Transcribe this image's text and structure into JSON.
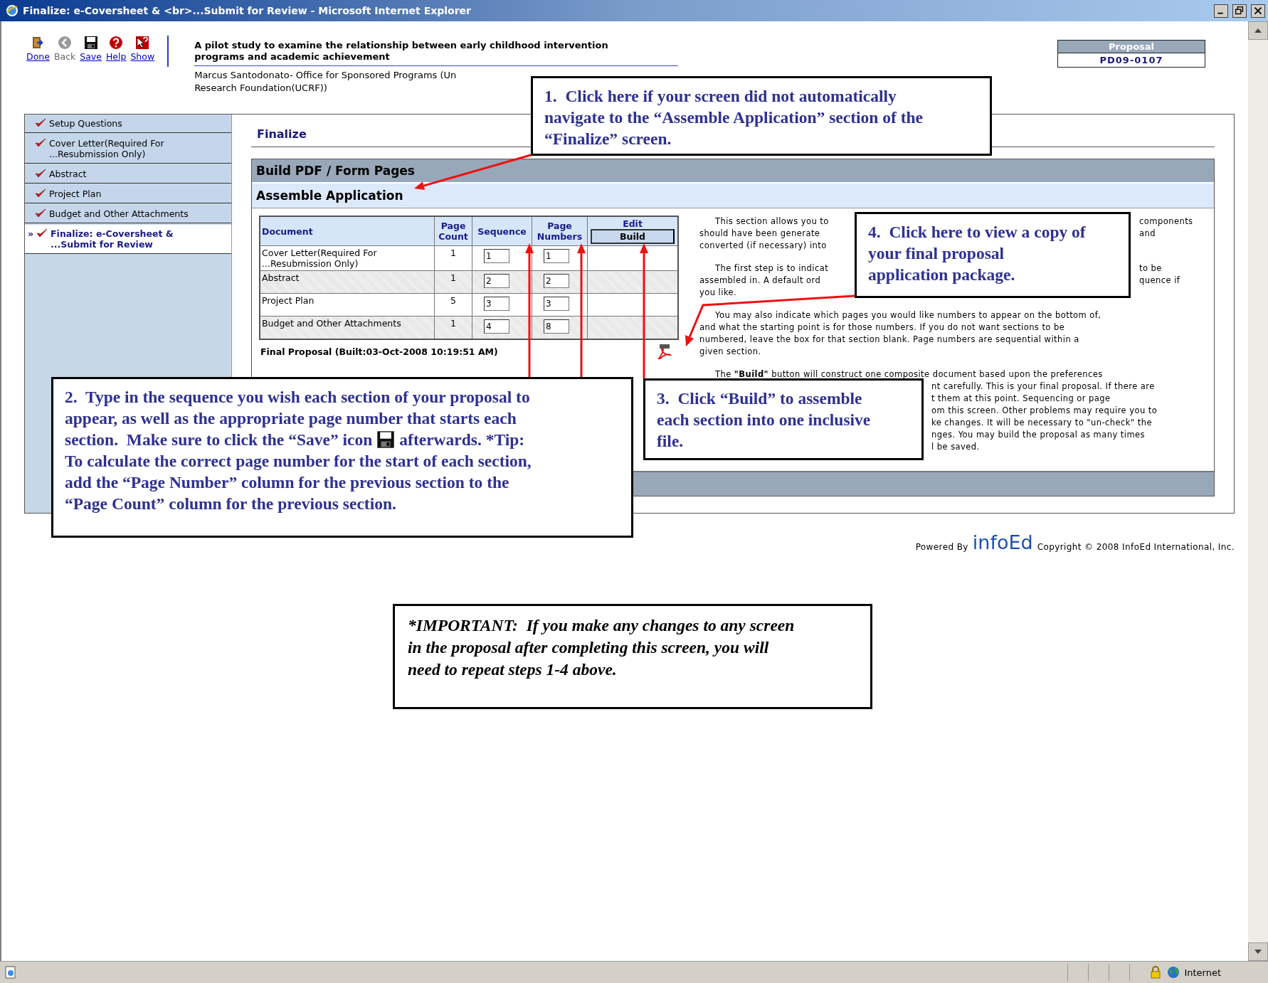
{
  "window": {
    "title": "Finalize: e-Coversheet & <br>...Submit for Review - Microsoft Internet Explorer"
  },
  "toolbar": [
    {
      "kind": "exit",
      "label": "Done",
      "disabled": false
    },
    {
      "kind": "back",
      "label": "Back",
      "disabled": true
    },
    {
      "kind": "save",
      "label": "Save",
      "disabled": false
    },
    {
      "kind": "help",
      "label": "Help",
      "disabled": false
    },
    {
      "kind": "show",
      "label": "Show",
      "disabled": false
    }
  ],
  "proposal": {
    "title_lines": [
      "A pilot study to examine the relationship between early childhood intervention",
      "programs and academic achievement"
    ],
    "investigator_lines": [
      "Marcus Santodonato- Office for Sponsored Programs (Un",
      "Research Foundation(UCRF))"
    ]
  },
  "proposal_box": {
    "label": "Proposal",
    "number": "PD09-0107"
  },
  "sidebar": {
    "items": [
      {
        "lines": [
          "Setup Questions"
        ],
        "selected": false
      },
      {
        "lines": [
          "Cover Letter(Required For",
          "...Resubmission Only)"
        ],
        "selected": false
      },
      {
        "lines": [
          "Abstract"
        ],
        "selected": false
      },
      {
        "lines": [
          "Project Plan"
        ],
        "selected": false
      },
      {
        "lines": [
          "Budget and Other Attachments"
        ],
        "selected": false
      },
      {
        "marker": "»",
        "lines": [
          "Finalize: e-Coversheet &",
          "...Submit for Review"
        ],
        "selected": true
      }
    ]
  },
  "section_title": "Finalize",
  "panel": {
    "title": "Build PDF / Form Pages",
    "subtitle": "Assemble Application"
  },
  "table": {
    "columns": [
      {
        "lines": [
          "Document"
        ]
      },
      {
        "lines": [
          "Page",
          "Count"
        ]
      },
      {
        "lines": [
          "Sequence"
        ]
      },
      {
        "lines": [
          "Page",
          "Numbers"
        ]
      }
    ],
    "edit_header": "Edit",
    "build_button": "Build",
    "rows": [
      {
        "document": [
          "Cover Letter(Required For",
          "...Resubmission Only)"
        ],
        "page_count": "1",
        "sequence": "1",
        "page_number": "1"
      },
      {
        "document": [
          "Abstract"
        ],
        "page_count": "1",
        "sequence": "2",
        "page_number": "2"
      },
      {
        "document": [
          "Project Plan"
        ],
        "page_count": "5",
        "sequence": "3",
        "page_number": "3"
      },
      {
        "document": [
          "Budget and Other Attachments"
        ],
        "page_count": "1",
        "sequence": "4",
        "page_number": "8"
      }
    ],
    "final_proposal": "Final Proposal (Built:03-Oct-2008 10:19:51 AM)"
  },
  "help": {
    "paragraphs": [
      {
        "lines": [
          {
            "kind": "split",
            "left": "This section allows you to",
            "right": "components"
          },
          {
            "kind": "split",
            "left": "should have been generate",
            "right": "and"
          },
          {
            "kind": "full",
            "text": "converted (if necessary) into"
          }
        ]
      },
      {
        "lines": [
          {
            "kind": "split",
            "left": "The first step is to indicat",
            "right": "to be"
          },
          {
            "kind": "split",
            "left": "assembled in. A default ord",
            "right": "quence if"
          },
          {
            "kind": "full",
            "text": "you like."
          }
        ]
      },
      {
        "lines": [
          {
            "kind": "full",
            "text": "You may also indicate which pages you would like numbers to appear on the bottom of,"
          },
          {
            "kind": "full",
            "text": "and what the starting point is for those numbers. If you do not want sections to be"
          },
          {
            "kind": "full",
            "text": "numbered, leave the box for that section blank. Page numbers are sequential within a"
          },
          {
            "kind": "full",
            "text": "given section."
          }
        ]
      },
      {
        "lines": [
          {
            "kind": "full",
            "text": "The **\"Build\"** button will construct one composite document based upon the preferences"
          },
          {
            "kind": "tail",
            "text": "nt carefully. This is your final proposal. If there are"
          },
          {
            "kind": "tail",
            "text": "t them at this point. Sequencing or page"
          },
          {
            "kind": "tail",
            "text": "om this screen. Other problems may require you to"
          },
          {
            "kind": "tail",
            "text": "ke changes. It will be necessary to \"un-check\" the"
          },
          {
            "kind": "tail",
            "text": "nges. You may build the proposal as many times"
          },
          {
            "kind": "tail",
            "text": "l be saved."
          }
        ]
      }
    ]
  },
  "footer": {
    "powered_by": "Powered By",
    "logo": "infoEd",
    "copyright": "Copyright © 2008 InfoEd International, Inc."
  },
  "callouts": [
    {
      "lines": [
        [
          {
            "kind": "text",
            "text": "1.  Click here if your screen did not automatically"
          }
        ],
        [
          {
            "kind": "text",
            "text": "navigate to the “Assemble Application” section of the"
          }
        ],
        [
          {
            "kind": "text",
            "text": "“Finalize” screen."
          }
        ]
      ]
    },
    {
      "lines": [
        [
          {
            "kind": "text",
            "text": "2.  Type in the sequence you wish each section of your proposal to"
          }
        ],
        [
          {
            "kind": "text",
            "text": "appear, as well as the appropriate page number that starts each"
          }
        ],
        [
          {
            "kind": "text",
            "text": "section.  Make sure to click the “Save” icon"
          },
          {
            "kind": "save-icon"
          },
          {
            "kind": "text",
            "text": "afterwards. *Tip:"
          }
        ],
        [
          {
            "kind": "text",
            "text": "To calculate the correct page number for the start of each section,"
          }
        ],
        [
          {
            "kind": "text",
            "text": "add the “Page Number” column for the previous section to the"
          }
        ],
        [
          {
            "kind": "text",
            "text": "“Page Count” column for the previous section."
          }
        ]
      ]
    },
    {
      "lines": [
        [
          {
            "kind": "text",
            "text": "3.  Click “Build” to assemble"
          }
        ],
        [
          {
            "kind": "text",
            "text": "each section into one inclusive"
          }
        ],
        [
          {
            "kind": "text",
            "text": "file."
          }
        ]
      ]
    },
    {
      "lines": [
        [
          {
            "kind": "text",
            "text": "4.  Click here to view a copy of"
          }
        ],
        [
          {
            "kind": "text",
            "text": "your final proposal"
          }
        ],
        [
          {
            "kind": "text",
            "text": "application package."
          }
        ]
      ]
    }
  ],
  "notice": [
    "*IMPORTANT:  If you make any changes to any screen",
    "in the proposal after completing this screen, you will",
    "need to repeat steps 1-4 above."
  ],
  "status_bar": {
    "zone": "Internet"
  }
}
